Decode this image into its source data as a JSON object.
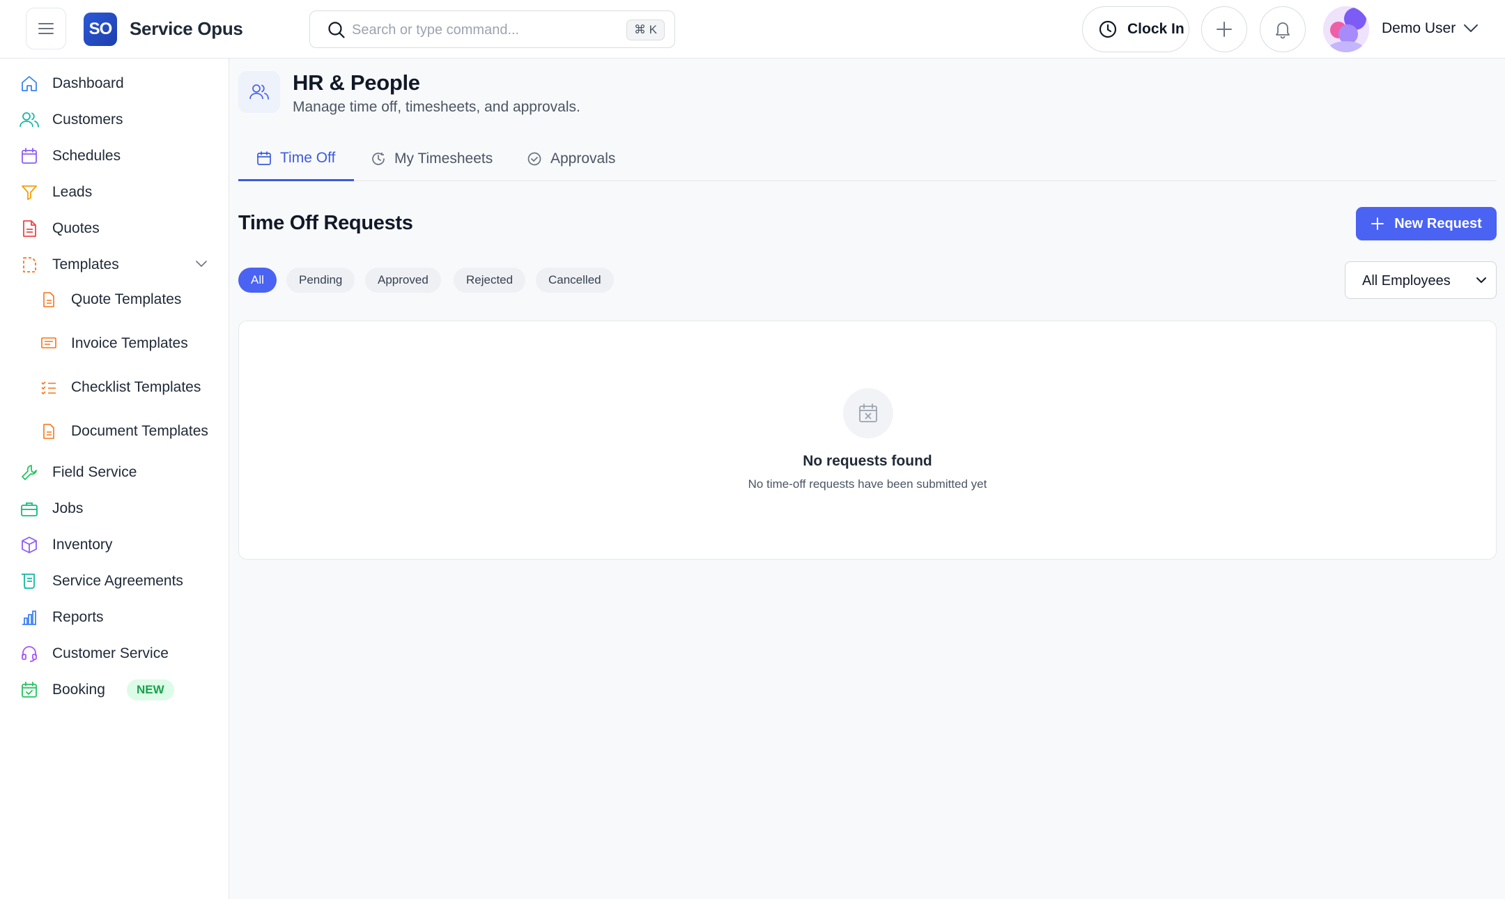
{
  "app": {
    "logo_initials": "SO",
    "name": "Service Opus"
  },
  "topbar": {
    "search_placeholder": "Search or type command...",
    "search_shortcut": "⌘ K",
    "clock_in_label": "Clock In",
    "user_name": "Demo User"
  },
  "sidebar": {
    "items": [
      {
        "label": "Dashboard",
        "icon": "home-icon",
        "color": "#3b82f6"
      },
      {
        "label": "Customers",
        "icon": "users-icon",
        "color": "#14b8a6"
      },
      {
        "label": "Schedules",
        "icon": "calendar-icon",
        "color": "#8b5cf6"
      },
      {
        "label": "Leads",
        "icon": "funnel-icon",
        "color": "#f59e0b"
      },
      {
        "label": "Quotes",
        "icon": "document-icon",
        "color": "#ef4444"
      },
      {
        "label": "Templates",
        "icon": "template-icon",
        "color": "#f97316",
        "expanded": true
      },
      {
        "label": "Field Service",
        "icon": "wrench-icon",
        "color": "#22c55e"
      },
      {
        "label": "Jobs",
        "icon": "briefcase-icon",
        "color": "#10b981"
      },
      {
        "label": "Inventory",
        "icon": "box-icon",
        "color": "#8b5cf6"
      },
      {
        "label": "Service Agreements",
        "icon": "scroll-icon",
        "color": "#14b8a6"
      },
      {
        "label": "Reports",
        "icon": "bar-chart-icon",
        "color": "#3b82f6"
      },
      {
        "label": "Customer Service",
        "icon": "headset-icon",
        "color": "#a855f7"
      },
      {
        "label": "Booking",
        "icon": "calendar-check-icon",
        "color": "#22c55e",
        "badge": "NEW"
      }
    ],
    "template_subitems": [
      {
        "label": "Quote Templates",
        "icon": "file-icon",
        "color": "#f97316"
      },
      {
        "label": "Invoice Templates",
        "icon": "invoice-icon",
        "color": "#f97316"
      },
      {
        "label": "Checklist Templates",
        "icon": "checklist-icon",
        "color": "#f97316"
      },
      {
        "label": "Document Templates",
        "icon": "file-icon",
        "color": "#f97316"
      }
    ]
  },
  "page": {
    "title": "HR & People",
    "subtitle": "Manage time off, timesheets, and approvals."
  },
  "tabs": [
    {
      "label": "Time Off",
      "icon": "calendar-icon",
      "active": true
    },
    {
      "label": "My Timesheets",
      "icon": "clock-history-icon",
      "active": false
    },
    {
      "label": "Approvals",
      "icon": "check-circle-icon",
      "active": false
    }
  ],
  "time_off": {
    "section_title": "Time Off Requests",
    "new_request_label": "New Request",
    "filters": [
      "All",
      "Pending",
      "Approved",
      "Rejected",
      "Cancelled"
    ],
    "active_filter": "All",
    "employee_filter": "All Employees",
    "empty_title": "No requests found",
    "empty_subtitle": "No time-off requests have been submitted yet"
  },
  "colors": {
    "accent": "#4a63f3",
    "active_tab": "#3b5bdb",
    "badge_new_bg": "#dcfce7",
    "badge_new_text": "#16a34a"
  }
}
